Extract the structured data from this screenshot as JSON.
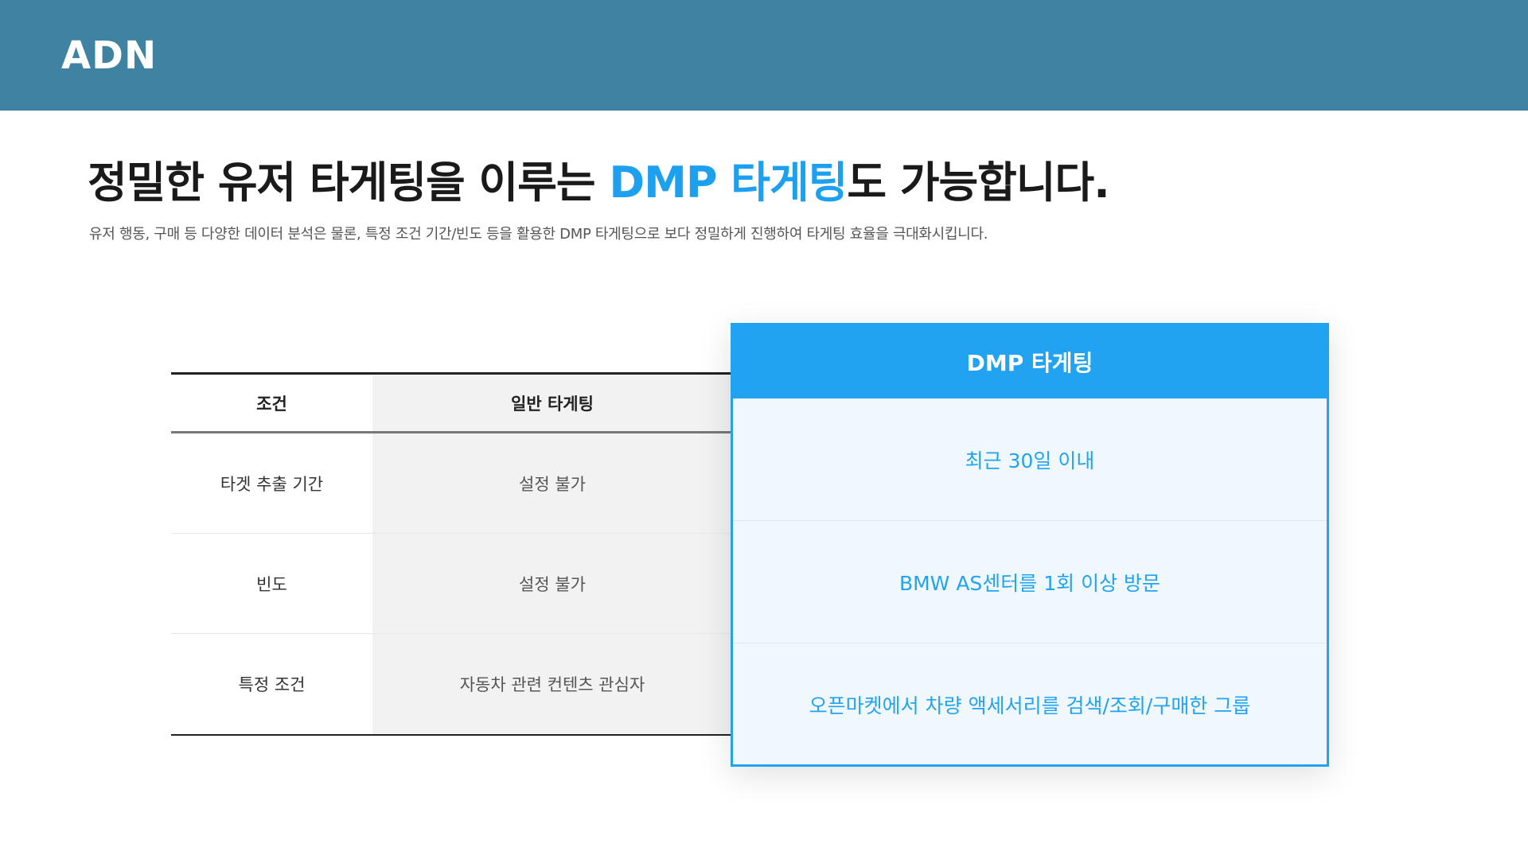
{
  "header": {
    "logo": "ADN"
  },
  "headline": {
    "prefix": "정밀한 유저 타게팅을 이루는 ",
    "accent": "DMP 타게팅",
    "suffix": "도 가능합니다."
  },
  "subtitle": "유저 행동, 구매 등 다양한 데이터 분석은 물론, 특정 조건 기간/빈도 등을 활용한 DMP 타게팅으로 보다 정밀하게 진행하여 타게팅 효율을 극대화시킵니다.",
  "table": {
    "headers": [
      "조건",
      "일반 타게팅"
    ],
    "rows": [
      {
        "condition": "타겟 추출 기간",
        "general": "설정 불가"
      },
      {
        "condition": "빈도",
        "general": "설정 불가"
      },
      {
        "condition": "특정 조건",
        "general": "자동차 관련 컨텐츠 관심자"
      }
    ]
  },
  "dmp": {
    "title": "DMP 타게팅",
    "rows": [
      "최근 30일 이내",
      "BMW AS센터를 1회 이상 방문",
      "오픈마켓에서 차량 액세서리를 검색/조회/구매한 그룹"
    ]
  },
  "colors": {
    "header_bg": "#3f82a2",
    "accent": "#1ea0f0",
    "dmp_bg": "#f0f8fe"
  }
}
